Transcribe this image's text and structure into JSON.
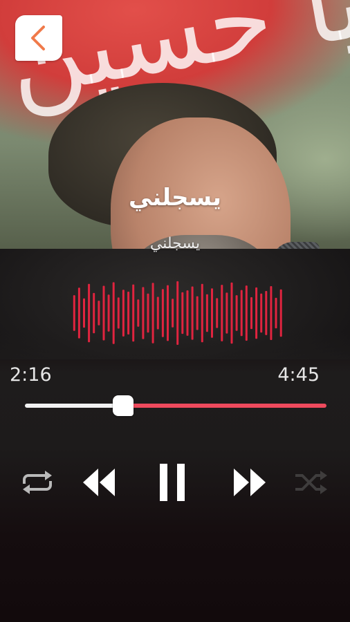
{
  "track": {
    "title": "يسجلني",
    "subtitle": "يسجلني"
  },
  "artwork": {
    "banner_text": "يا حسين"
  },
  "player": {
    "elapsed": "2:16",
    "total": "4:45",
    "progress": 0.325,
    "state": "playing"
  },
  "waveform": {
    "color": "#e0243f",
    "bars": [
      0.55,
      0.78,
      0.45,
      0.9,
      0.62,
      0.38,
      0.84,
      0.57,
      0.95,
      0.48,
      0.72,
      0.66,
      0.88,
      0.42,
      0.8,
      0.6,
      0.93,
      0.5,
      0.74,
      0.86,
      0.44,
      0.98,
      0.64,
      0.7,
      0.82,
      0.52,
      0.9,
      0.58,
      0.76,
      0.46,
      0.87,
      0.63,
      0.94,
      0.55,
      0.71,
      0.85,
      0.49,
      0.79,
      0.6,
      0.68,
      0.83,
      0.47,
      0.73
    ]
  },
  "icons": {
    "back": "chevron-left-icon",
    "repeat": "repeat-icon",
    "rewind": "rewind-icon",
    "pause": "pause-icon",
    "forward": "fast-forward-icon",
    "shuffle": "shuffle-icon"
  },
  "colors": {
    "accent": "#ef4a5d",
    "back_chevron": "#f07a4a",
    "background": "#140c0e"
  }
}
